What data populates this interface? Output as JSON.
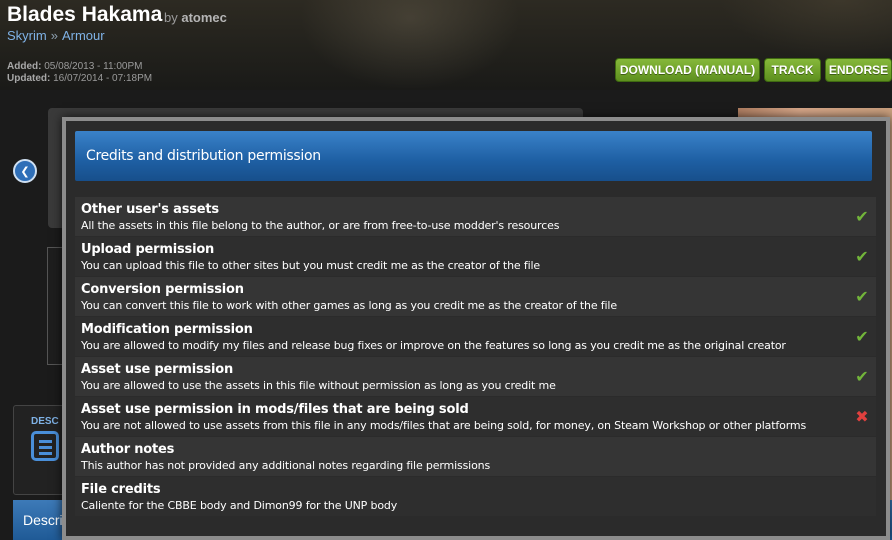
{
  "header": {
    "title": "Blades Hakama",
    "by_prefix": "by",
    "author": "atomec",
    "breadcrumb": [
      "Skyrim",
      "Armour"
    ],
    "breadcrumb_sep": "»",
    "added_label": "Added:",
    "added_value": "05/08/2013 - 11:00PM",
    "updated_label": "Updated:",
    "updated_value": "16/07/2014 - 07:18PM",
    "buttons": {
      "download": "DOWNLOAD (MANUAL)",
      "track": "TRACK",
      "endorse": "ENDORSE"
    }
  },
  "background": {
    "desc_tab_label": "DESC",
    "bottom_bar_label": "Descri"
  },
  "modal": {
    "title": "Credits and distribution permission",
    "rows": [
      {
        "title": "Other user's assets",
        "desc": "All the assets in this file belong to the author, or are from free-to-use modder's resources",
        "status": "allowed"
      },
      {
        "title": "Upload permission",
        "desc": "You can upload this file to other sites but you must credit me as the creator of the file",
        "status": "allowed"
      },
      {
        "title": "Conversion permission",
        "desc": "You can convert this file to work with other games as long as you credit me as the creator of the file",
        "status": "allowed"
      },
      {
        "title": "Modification permission",
        "desc": "You are allowed to modify my files and release bug fixes or improve on the features so long as you credit me as the original creator",
        "status": "allowed"
      },
      {
        "title": "Asset use permission",
        "desc": "You are allowed to use the assets in this file without permission as long as you credit me",
        "status": "allowed"
      },
      {
        "title": "Asset use permission in mods/files that are being sold",
        "desc": "You are not allowed to use assets from this file in any mods/files that are being sold, for money, on Steam Workshop or other platforms",
        "status": "denied"
      },
      {
        "title": "Author notes",
        "desc": "This author has not provided any additional notes regarding file permissions",
        "status": "none"
      },
      {
        "title": "File credits",
        "desc": "Caliente for the CBBE body and Dimon99 for the UNP body",
        "status": "none"
      }
    ]
  },
  "icons": {
    "allowed": "check-icon",
    "denied": "cross-icon",
    "back": "chevron-left-icon",
    "desc": "document-list-icon"
  },
  "colors": {
    "accent_blue": "#1e5fa3",
    "button_green": "#5d8f1e",
    "allowed_green": "#72b53a",
    "denied_red": "#e0403e"
  }
}
